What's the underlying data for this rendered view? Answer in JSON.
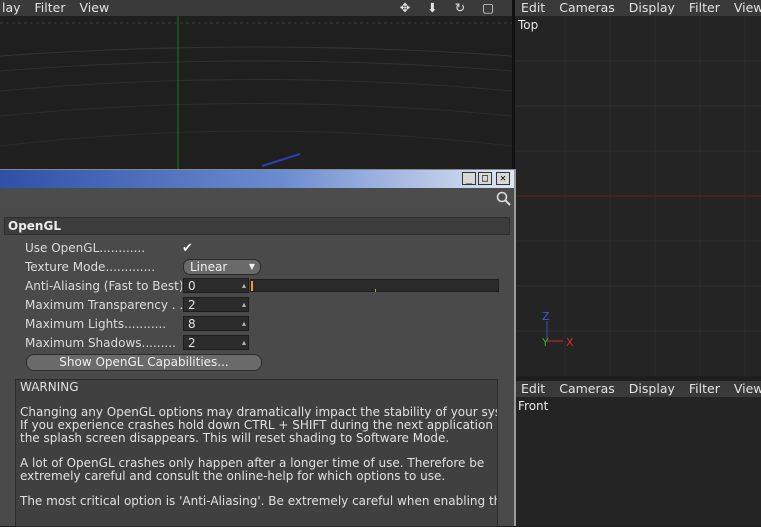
{
  "left_viewport": {
    "menu": [
      "lay",
      "Filter",
      "View"
    ],
    "toolbar_icons": [
      "move-icon",
      "zoom-icon",
      "rotate-icon",
      "maximize-icon"
    ]
  },
  "top_viewport": {
    "menu": [
      "Edit",
      "Cameras",
      "Display",
      "Filter",
      "View"
    ],
    "label": "Top",
    "axis_x": "X",
    "axis_y": "Y",
    "axis_z": "Z"
  },
  "front_viewport": {
    "menu": [
      "Edit",
      "Cameras",
      "Display",
      "Filter",
      "View"
    ],
    "label": "Front"
  },
  "dialog": {
    "section_title": "OpenGL",
    "settings": {
      "use_opengl": {
        "label": "Use OpenGL",
        "check": "✔"
      },
      "texture_mode": {
        "label": "Texture Mode",
        "value": "Linear"
      },
      "anti_aliasing": {
        "label": "Anti-Aliasing (Fast to Best)",
        "value": "0",
        "slider_fraction": 0
      },
      "max_transparency": {
        "label": "Maximum Transparency",
        "value": "2"
      },
      "max_lights": {
        "label": "Maximum Lights",
        "value": "8"
      },
      "max_shadows": {
        "label": "Maximum Shadows",
        "value": "2"
      }
    },
    "capabilities_button": "Show OpenGL Capabilities...",
    "warning": {
      "title": "WARNING",
      "lines": [
        "Changing any OpenGL options may dramatically impact the stability of your system!",
        "If you experience crashes hold down CTRL + SHIFT during the next application start",
        "the splash screen disappears. This will reset shading to Software Mode.",
        "A lot of OpenGL crashes only happen after a longer time of use. Therefore be",
        "extremely careful and consult the online-help for which options to use.",
        "The most critical option is 'Anti-Aliasing'. Be extremely careful when enabling this o"
      ]
    }
  }
}
